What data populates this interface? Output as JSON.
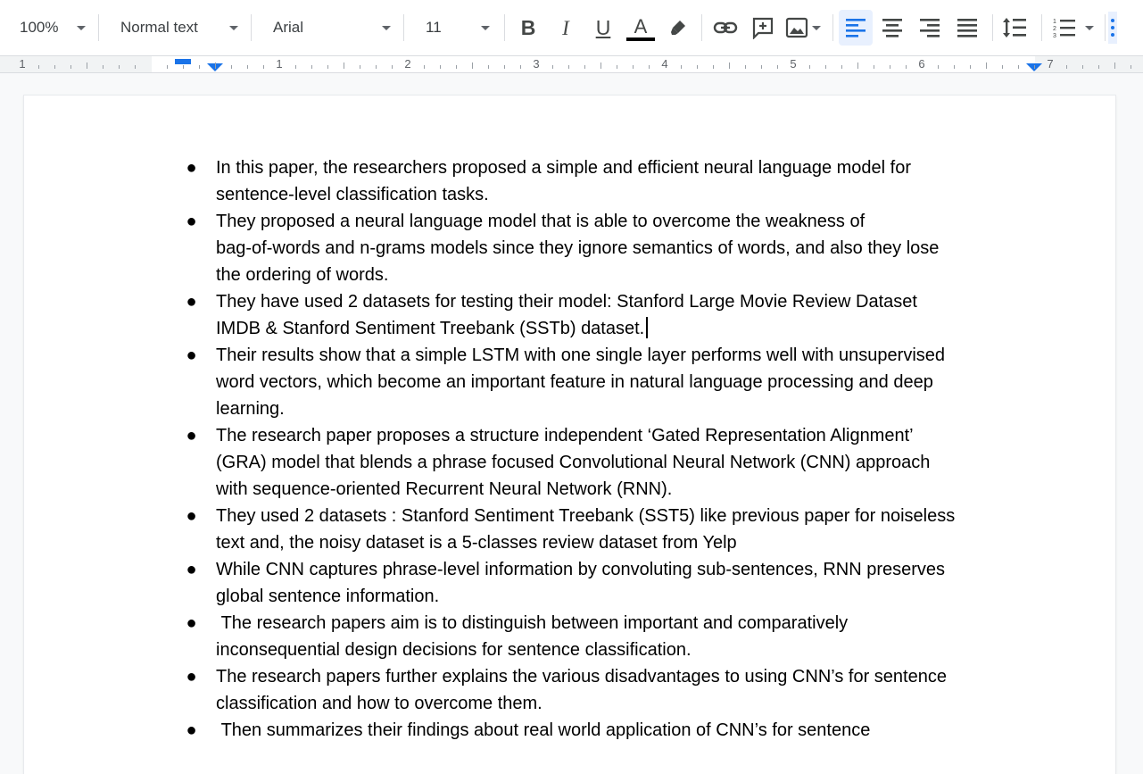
{
  "toolbar": {
    "zoom": "100%",
    "style": "Normal text",
    "font": "Arial",
    "size": "11",
    "bold_glyph": "B",
    "italic_glyph": "I",
    "underline_glyph": "U",
    "text_color_glyph": "A",
    "text_color": "#000000",
    "active_alignment": "left"
  },
  "ruler": {
    "numbers": [
      "1",
      "1",
      "2",
      "3",
      "4",
      "5",
      "6",
      "7"
    ]
  },
  "document": {
    "bullet_char": "●",
    "items": [
      "In this paper, the researchers proposed a simple and efficient neural language model for\nsentence-level classification tasks.",
      "They proposed a neural language model that is able to overcome the weakness of\nbag-of-words and n-grams models since they ignore semantics of words, and also they lose\nthe ordering of words.",
      "They have used 2 datasets for testing their model: Stanford Large Movie Review Dataset\nIMDB & Stanford Sentiment Treebank (SSTb) dataset.",
      "Their results show that a simple LSTM with one single layer performs well with unsupervised\nword vectors, which become an important feature in natural language processing and deep\nlearning.",
      "The research paper proposes a structure independent ‘Gated Representation Alignment’\n(GRA) model that blends a phrase focused Convolutional Neural Network (CNN) approach\nwith sequence-oriented Recurrent Neural Network (RNN).",
      "They used 2 datasets : Stanford Sentiment Treebank (SST5) like previous paper for noiseless\ntext and, the noisy dataset is a 5-classes review dataset from Yelp",
      "While CNN captures phrase-level information by convoluting sub-sentences, RNN preserves\nglobal sentence information.",
      " The research papers aim is to distinguish between important and comparatively\ninconsequential design decisions for sentence classification.",
      "The research papers further explains the various disadvantages to using CNN’s for sentence\nclassification and how to overcome them.",
      " Then summarizes their findings about real world application of CNN’s for sentence"
    ],
    "cursor_item_index": 2
  }
}
